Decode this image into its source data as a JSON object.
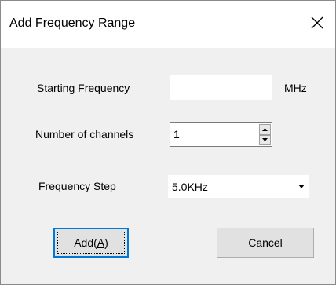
{
  "window": {
    "title": "Add Frequency Range"
  },
  "fields": {
    "starting_frequency": {
      "label": "Starting Frequency",
      "value": "",
      "unit": "MHz"
    },
    "channels": {
      "label": "Number of channels",
      "value": "1"
    },
    "frequency_step": {
      "label": "Frequency Step",
      "value": "5.0KHz"
    }
  },
  "buttons": {
    "add_prefix": "Add(",
    "add_accel": "A",
    "add_suffix": ")",
    "cancel": "Cancel"
  },
  "icons": {
    "close": "close-icon",
    "spin_up": "spin-up-icon",
    "spin_down": "spin-down-icon",
    "dropdown": "chevron-down-icon"
  },
  "colors": {
    "dialog_bg": "#f0f0f0",
    "titlebar_bg": "#ffffff",
    "accent_border": "#0078d7"
  }
}
